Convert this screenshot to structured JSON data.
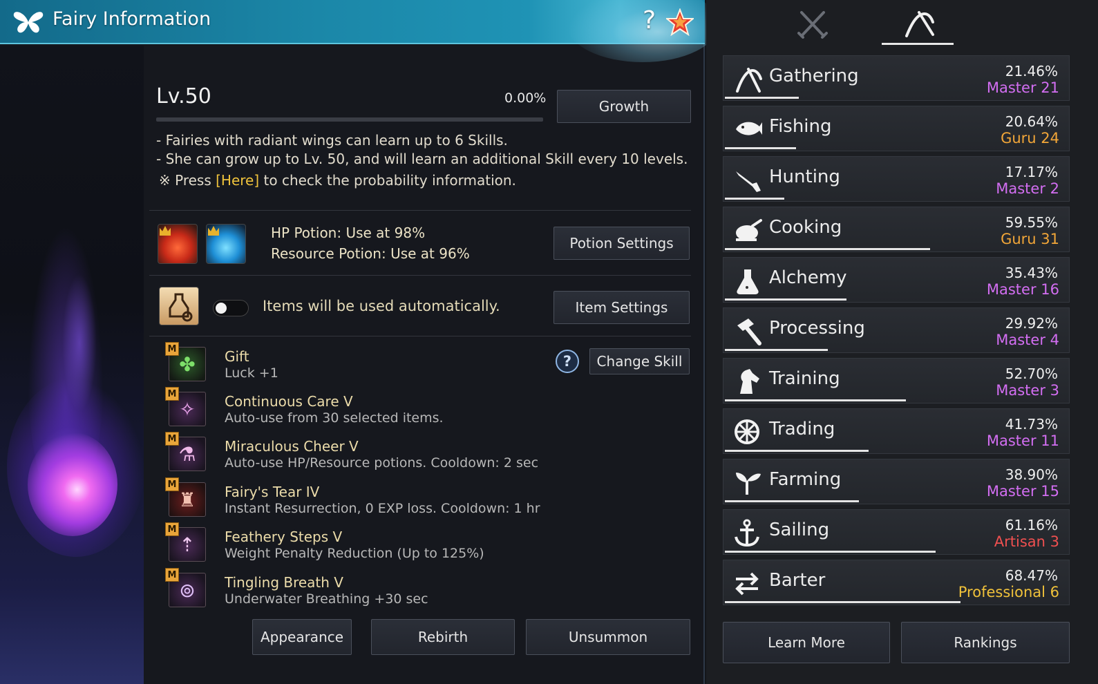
{
  "window": {
    "title": "Fairy Information",
    "help_glyph": "?",
    "icons": [
      "butterfly-icon",
      "help-icon",
      "favorite-star-icon"
    ]
  },
  "fairy": {
    "level": "Lv.50",
    "exp_percent": "0.00%",
    "exp_fraction": 0.0,
    "growth_button": "Growth",
    "info_line1": "- Fairies with radiant wings can learn up to 6 Skills.",
    "info_line2": "- She can grow up to Lv. 50, and will learn an additional Skill every 10 levels.",
    "info_line3_prefix": "※ Press ",
    "info_line3_link": "[Here]",
    "info_line3_suffix": " to check the probability information.",
    "hp_potion": "HP Potion: Use at 98%",
    "resource_potion": "Resource Potion: Use at 96%",
    "potion_settings_button": "Potion Settings",
    "auto_use_text": "Items will be used automatically.",
    "auto_use_on": false,
    "item_settings_button": "Item Settings",
    "change_skill_button": "Change Skill",
    "skill_badge": "M",
    "skills": [
      {
        "name": "Gift",
        "desc": "Luck +1",
        "icon": "clover-icon"
      },
      {
        "name": "Continuous Care V",
        "desc": "Auto-use from 30 selected items.",
        "icon": "fairy-icon"
      },
      {
        "name": "Miraculous Cheer V",
        "desc": "Auto-use HP/Resource potions. Cooldown: 2 sec",
        "icon": "potion-flask-icon"
      },
      {
        "name": "Fairy's Tear IV",
        "desc": "Instant Resurrection, 0 EXP loss. Cooldown: 1 hr",
        "icon": "tear-bottle-icon"
      },
      {
        "name": "Feathery Steps V",
        "desc": "Weight Penalty Reduction (Up to 125%)",
        "icon": "weight-icon"
      },
      {
        "name": "Tingling Breath V",
        "desc": "Underwater Breathing +30 sec",
        "icon": "bubble-icon"
      }
    ],
    "appearance_button": "Appearance",
    "rebirth_button": "Rebirth",
    "unsummon_button": "Unsummon"
  },
  "life_skills": {
    "tabs": [
      {
        "icon": "crossed-swords-icon",
        "active": false
      },
      {
        "icon": "pickaxe-icon",
        "active": true
      }
    ],
    "skills": [
      {
        "name": "Gathering",
        "percent": "21.46%",
        "rank": "Master 21",
        "rank_class": "master",
        "progress": 0.2146,
        "icon": "gathering-icon"
      },
      {
        "name": "Fishing",
        "percent": "20.64%",
        "rank": "Guru 24",
        "rank_class": "guru",
        "progress": 0.2064,
        "icon": "fish-icon"
      },
      {
        "name": "Hunting",
        "percent": "17.17%",
        "rank": "Master 2",
        "rank_class": "master",
        "progress": 0.1717,
        "icon": "rifle-icon"
      },
      {
        "name": "Cooking",
        "percent": "59.55%",
        "rank": "Guru 31",
        "rank_class": "guru",
        "progress": 0.5955,
        "icon": "cooking-icon"
      },
      {
        "name": "Alchemy",
        "percent": "35.43%",
        "rank": "Master 16",
        "rank_class": "master",
        "progress": 0.3543,
        "icon": "flask-icon"
      },
      {
        "name": "Processing",
        "percent": "29.92%",
        "rank": "Master 4",
        "rank_class": "master",
        "progress": 0.2992,
        "icon": "hammer-icon"
      },
      {
        "name": "Training",
        "percent": "52.70%",
        "rank": "Master 3",
        "rank_class": "master",
        "progress": 0.527,
        "icon": "horse-icon"
      },
      {
        "name": "Trading",
        "percent": "41.73%",
        "rank": "Master 11",
        "rank_class": "master",
        "progress": 0.4173,
        "icon": "wheel-icon"
      },
      {
        "name": "Farming",
        "percent": "38.90%",
        "rank": "Master 15",
        "rank_class": "master",
        "progress": 0.389,
        "icon": "sprout-icon"
      },
      {
        "name": "Sailing",
        "percent": "61.16%",
        "rank": "Artisan 3",
        "rank_class": "artisan",
        "progress": 0.6116,
        "icon": "anchor-icon"
      },
      {
        "name": "Barter",
        "percent": "68.47%",
        "rank": "Professional 6",
        "rank_class": "pro",
        "progress": 0.6847,
        "icon": "exchange-arrows-icon"
      }
    ],
    "learn_more_button": "Learn More",
    "rankings_button": "Rankings"
  },
  "colors": {
    "title_bar": "#1b87a8",
    "master": "#d36ef2",
    "guru": "#f2a638",
    "artisan": "#f05050",
    "professional": "#f0c23a",
    "highlight": "#f0c33c"
  }
}
